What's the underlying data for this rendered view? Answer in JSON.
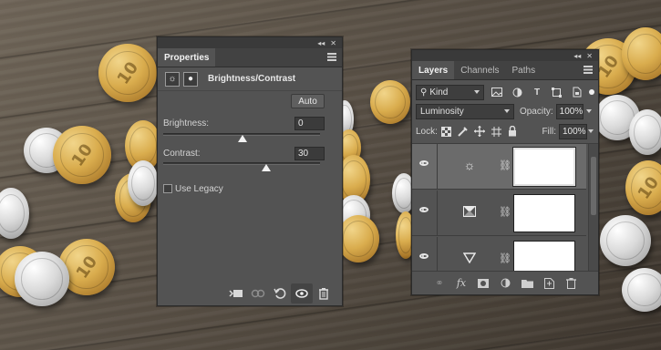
{
  "properties": {
    "tab": "Properties",
    "title": "Brightness/Contrast",
    "auto_label": "Auto",
    "brightness_label": "Brightness:",
    "brightness_value": "0",
    "contrast_label": "Contrast:",
    "contrast_value": "30",
    "legacy_label": "Use Legacy"
  },
  "layers": {
    "tabs": [
      "Layers",
      "Channels",
      "Paths"
    ],
    "filter_kind": "Kind",
    "blend_mode": "Luminosity",
    "opacity_label": "Opacity:",
    "opacity_value": "100%",
    "lock_label": "Lock:",
    "fill_label": "Fill:",
    "fill_value": "100%"
  },
  "coins": {
    "label": "10"
  }
}
